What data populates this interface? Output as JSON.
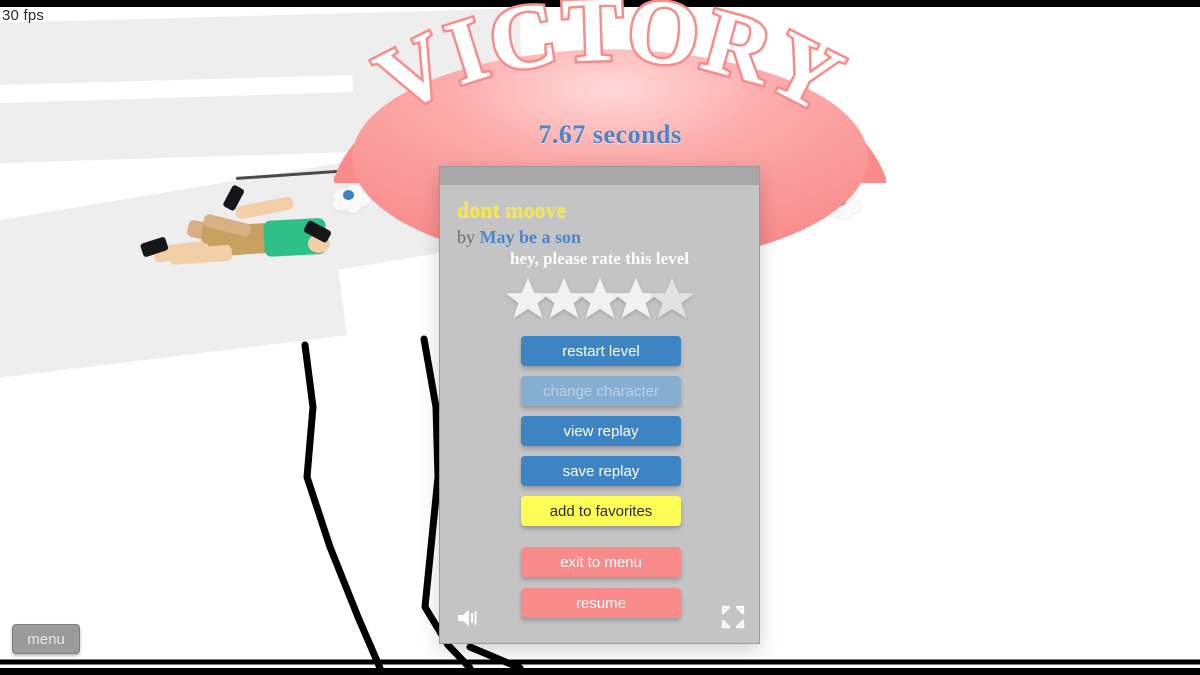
{
  "hud": {
    "fps": "30 fps",
    "menu_label": "menu"
  },
  "banner": {
    "victory_text": "VICTORY",
    "time_text": "7.67 seconds",
    "banner_color": "#f98b8b",
    "time_color": "#4a86c8"
  },
  "panel": {
    "level_title": "dont moove",
    "by_prefix": "by",
    "author": "May be a son",
    "rate_prompt": "hey, please rate this level",
    "stars": {
      "count": 5,
      "filled": 0,
      "star_color": "#f2f2f2"
    },
    "buttons": [
      {
        "id": "restart",
        "label": "restart level",
        "style": "blue"
      },
      {
        "id": "change",
        "label": "change character",
        "style": "faded"
      },
      {
        "id": "view",
        "label": "view replay",
        "style": "blue"
      },
      {
        "id": "save",
        "label": "save replay",
        "style": "blue"
      },
      {
        "id": "favorites",
        "label": "add to favorites",
        "style": "yellow"
      },
      {
        "id": "exit",
        "label": "exit to menu",
        "style": "pink"
      },
      {
        "id": "resume",
        "label": "resume",
        "style": "pink"
      }
    ],
    "icons": {
      "sound": "speaker-icon",
      "fullscreen": "fullscreen-icon"
    },
    "colors": {
      "panel_bg": "#c4c4c4",
      "blue": "#3c84c4",
      "blue_faded": "#86aed0",
      "yellow": "#fdfd55",
      "pink": "#f98b8b",
      "title_yellow": "#f5e642",
      "author_blue": "#4a86c8"
    }
  },
  "character": {
    "shirt_color": "#2fc08a",
    "shorts_color": "#c8a060",
    "skin_color": "#f2cfa6",
    "shoe_color": "#15161a"
  },
  "scene": {
    "platform_color": "#eeeeee",
    "ink_color": "#000000",
    "flower_petal": "#fafafa",
    "flower_center": "#3b82c4"
  }
}
